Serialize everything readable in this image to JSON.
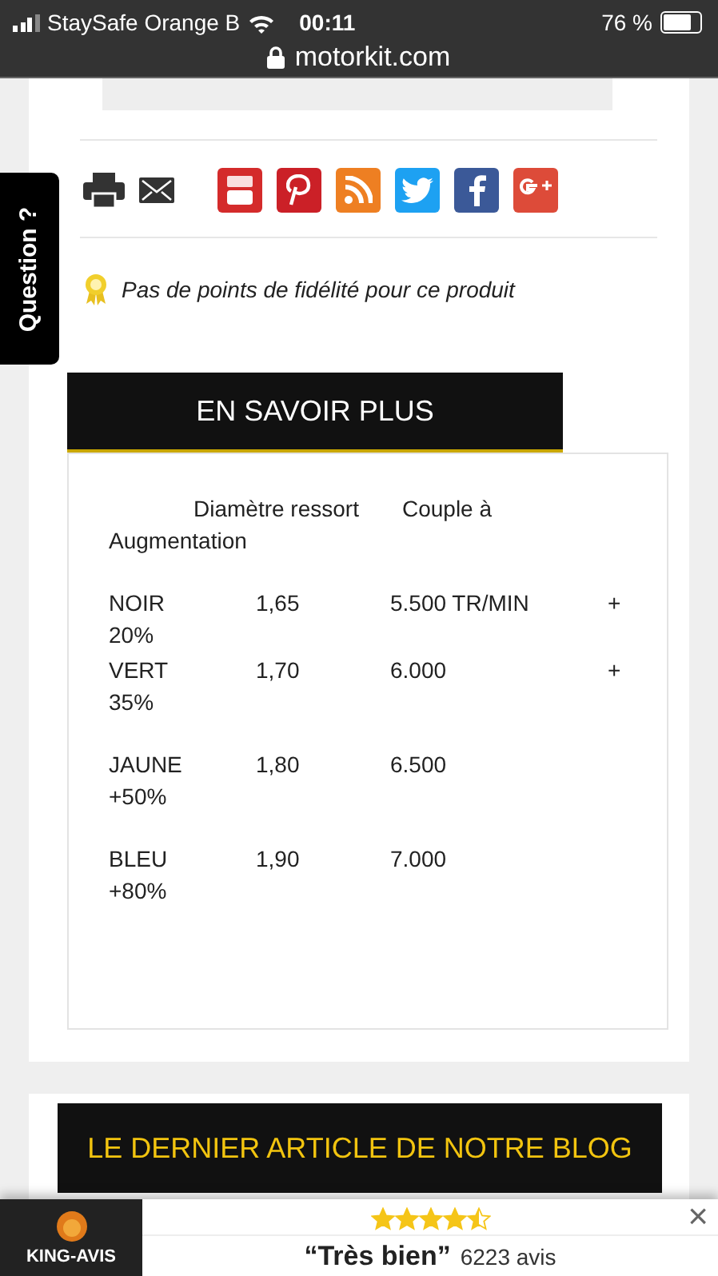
{
  "status_bar": {
    "carrier": "StaySafe Orange B",
    "time": "00:11",
    "battery": "76 %"
  },
  "address_bar": {
    "url": "motorkit.com"
  },
  "share_icons": [
    {
      "kind": "print"
    },
    {
      "kind": "mail"
    },
    {
      "kind": "youtube"
    },
    {
      "kind": "pinterest"
    },
    {
      "kind": "rss"
    },
    {
      "kind": "twitter"
    },
    {
      "kind": "facebook"
    },
    {
      "kind": "googleplus"
    }
  ],
  "loyalty_note": "Pas de points de fidélité pour ce produit",
  "question_tab": "Question ?",
  "section_tab": "EN SAVOIR PLUS",
  "table_header": [
    "Diamètre ressort",
    "Couple à",
    "Augmentation"
  ],
  "table_rows": [
    {
      "cells": [
        "NOIR",
        "1,65",
        "5.500 TR/MIN",
        "+"
      ],
      "wrap": "20%"
    },
    {
      "cells": [
        "VERT",
        "1,70",
        "6.000",
        "+"
      ],
      "wrap": "35%"
    },
    {
      "cells": [
        "JAUNE",
        "1,80",
        "6.500",
        ""
      ],
      "wrap": "+50%"
    },
    {
      "cells": [
        "BLEU",
        "1,90",
        "7.000",
        ""
      ],
      "wrap": "+80%"
    }
  ],
  "blog_banner": "LE DERNIER ARTICLE DE NOTRE BLOG",
  "review_bar": {
    "brand": "KING-AVIS",
    "stars": 4.5,
    "rating": "“Très bien”",
    "count": "6223 avis",
    "close": "×"
  }
}
